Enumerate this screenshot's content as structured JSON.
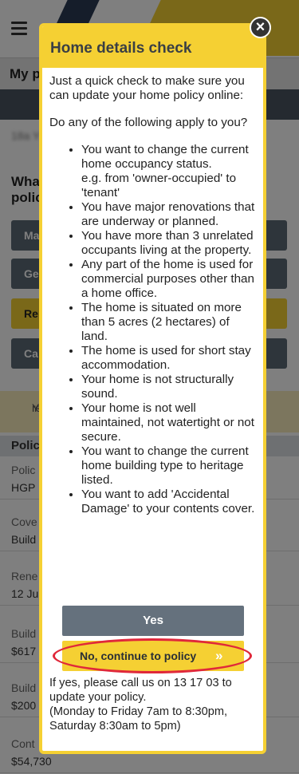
{
  "background": {
    "subheader_title": "My p",
    "address": "18a Y",
    "question": [
      "Wha",
      "polic"
    ],
    "buttons": [
      {
        "label": "Ma",
        "style": "grey"
      },
      {
        "label": "Ge",
        "style": "grey"
      },
      {
        "label": "Re",
        "style": "yellow"
      },
      {
        "label": "Ca",
        "style": "grey"
      }
    ],
    "notice": [
      "You",
      "rene"
    ],
    "section_title": "Polic",
    "rows": [
      {
        "label": "Polic",
        "value": "HGP"
      },
      {
        "label": "Cove",
        "value": "Build"
      },
      {
        "label": "Rene",
        "value": "12 Ju"
      },
      {
        "label": "Build",
        "value": "$617"
      },
      {
        "label": "Build",
        "value": "$200"
      },
      {
        "label": "Cont",
        "value": "$54,730"
      }
    ]
  },
  "modal": {
    "title": "Home details check",
    "intro": "Just a quick check to make sure you can update your home policy online:",
    "question": "Do any of the following apply to you?",
    "items": [
      {
        "text": "You want to change the current home occupancy status.",
        "example": "e.g. from 'owner-occupied' to 'tenant'"
      },
      {
        "text": "You have major renovations that are underway or planned."
      },
      {
        "text": "You have more than 3 unrelated occupants living at the property."
      },
      {
        "text": "Any part of the home is used for commercial purposes other than a home office."
      },
      {
        "text": "The home is situated on more than 5 acres (2 hectares) of land."
      },
      {
        "text": "The home is used for short stay accommodation."
      },
      {
        "text": "Your home is not structurally sound."
      },
      {
        "text": "Your home is not well maintained, not watertight or not secure."
      },
      {
        "text": "You want to change the current home building type to heritage listed."
      },
      {
        "text": "You want to add 'Accidental Damage' to your contents cover."
      }
    ],
    "yes_label": "Yes",
    "no_label": "No, continue to policy",
    "no_chevron": "»",
    "close_icon": "×",
    "footer": {
      "line1": "If yes, please call us on 13 17 03 to update your policy.",
      "line2": "(Monday to Friday 7am to 8:30pm, Saturday 8:30am to 5pm)"
    }
  },
  "colors": {
    "accent": "#f5d033",
    "button_grey": "#65717d",
    "highlight": "#e0283a"
  }
}
